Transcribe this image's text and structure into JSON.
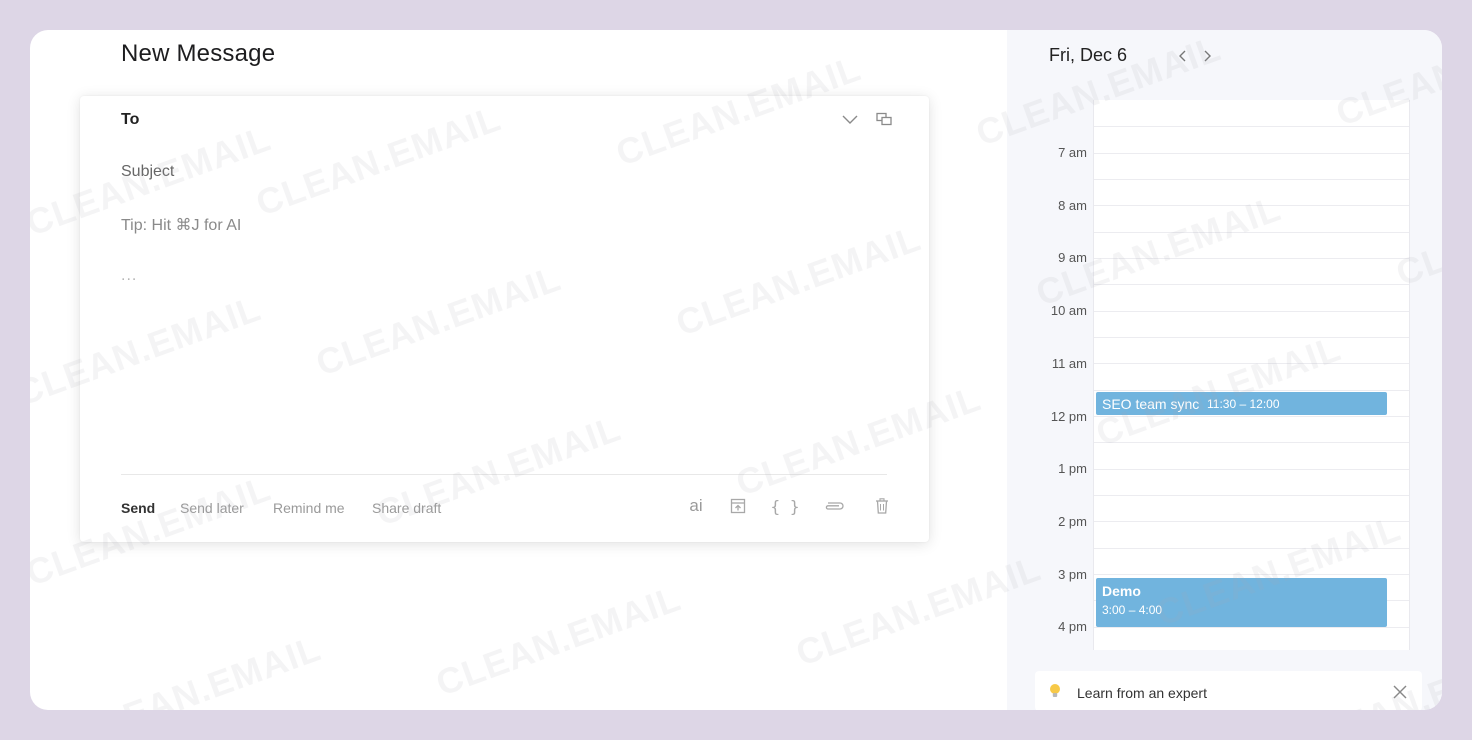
{
  "compose": {
    "title": "New Message",
    "to_label": "To",
    "subject_label": "Subject",
    "tip": "Tip: Hit ⌘J for AI",
    "body_placeholder": "...",
    "send_label": "Send",
    "send_later_label": "Send later",
    "remind_me_label": "Remind me",
    "share_draft_label": "Share draft",
    "ai_label": "ai",
    "template_label": "{ }"
  },
  "calendar": {
    "date": "Fri, Dec 6",
    "hours": [
      "7 am",
      "8 am",
      "9 am",
      "10 am",
      "11 am",
      "12 pm",
      "1 pm",
      "2 pm",
      "3 pm",
      "4 pm"
    ],
    "events": [
      {
        "title": "SEO team sync",
        "time": "11:30 – 12:00"
      },
      {
        "title": "Demo",
        "time": "3:00 – 4:00"
      }
    ],
    "accent_color": "#71b4de"
  },
  "tipbar": {
    "text": "Learn from an expert"
  },
  "watermark": "CLEAN.EMAIL"
}
